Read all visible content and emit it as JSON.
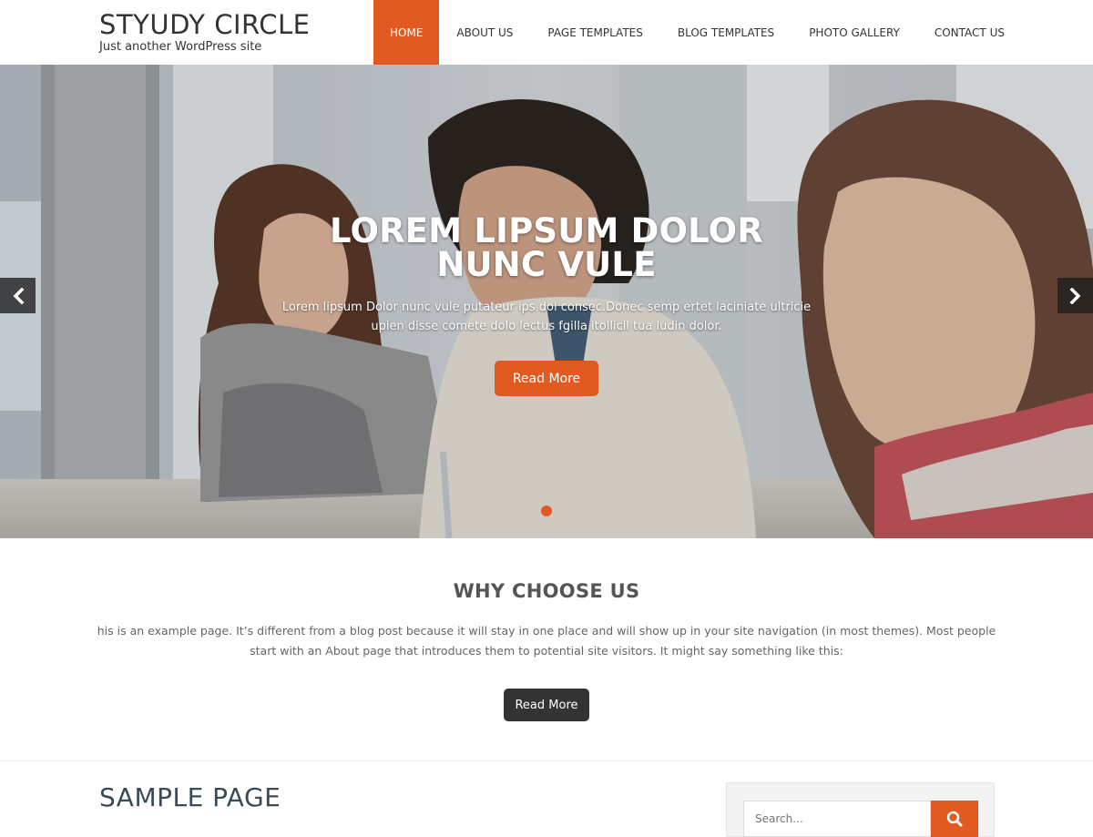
{
  "site": {
    "title": "STYUDY CIRCLE",
    "tagline": "Just another WordPress site"
  },
  "nav": {
    "items": [
      {
        "label": "HOME",
        "active": true
      },
      {
        "label": "ABOUT US"
      },
      {
        "label": "PAGE TEMPLATES"
      },
      {
        "label": "BLOG TEMPLATES"
      },
      {
        "label": "PHOTO GALLERY"
      },
      {
        "label": "CONTACT US"
      }
    ]
  },
  "hero": {
    "heading": "LOREM LIPSUM DOLOR NUNC VULE",
    "text": "Lorem lipsum Dolor nunc vule putateur ips dol consec.Donec semp ertet laciniate ultricie upien disse comete dolo lectus fgilla itollicil tua ludin dolor.",
    "button": "Read More",
    "prev_icon": "chevron-left-icon",
    "next_icon": "chevron-right-icon"
  },
  "why": {
    "title": "WHY CHOOSE US",
    "text": "his is an example page. It’s different from a blog post because it will stay in one place and will show up in your site navigation (in most themes). Most people start with an About page that introduces them to potential site visitors. It might say something like this:",
    "button": "Read More"
  },
  "sample": {
    "title": "SAMPLE PAGE"
  },
  "search": {
    "placeholder": "Search...",
    "icon": "search-icon"
  },
  "colors": {
    "accent": "#e05a22",
    "dark_button": "#333333"
  }
}
